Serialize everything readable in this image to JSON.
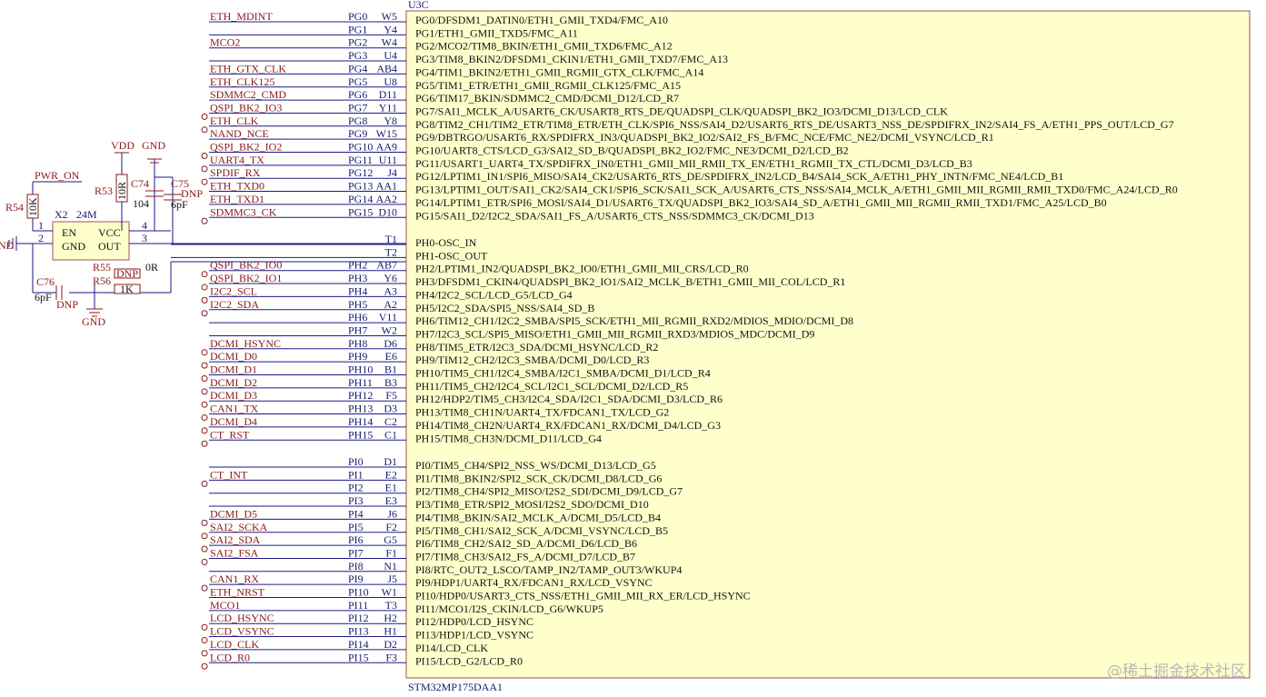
{
  "part": {
    "ref": "U3C",
    "name": "STM32MP175DAA1"
  },
  "pins_g": [
    {
      "net": "ETH_MDINT",
      "open": false,
      "pin": "PG0",
      "ball": "W5",
      "func": "PG0/DFSDM1_DATIN0/ETH1_GMII_TXD4/FMC_A10"
    },
    {
      "net": "",
      "open": false,
      "pin": "PG1",
      "ball": "Y4",
      "func": "PG1/ETH1_GMII_TXD5/FMC_A11"
    },
    {
      "net": "MCO2",
      "open": false,
      "pin": "PG2",
      "ball": "W4",
      "func": "PG2/MCO2/TIM8_BKIN/ETH1_GMII_TXD6/FMC_A12"
    },
    {
      "net": "",
      "open": false,
      "pin": "PG3",
      "ball": "U4",
      "func": "PG3/TIM8_BKIN2/DFSDM1_CKIN1/ETH1_GMII_TXD7/FMC_A13"
    },
    {
      "net": "ETH_GTX_CLK",
      "open": false,
      "pin": "PG4",
      "ball": "AB4",
      "func": "PG4/TIM1_BKIN2/ETH1_GMII_RGMII_GTX_CLK/FMC_A14"
    },
    {
      "net": "ETH_CLK125",
      "open": false,
      "pin": "PG5",
      "ball": "U8",
      "func": "PG5/TIM1_ETR/ETH1_GMII_RGMII_CLK125/FMC_A15"
    },
    {
      "net": "SDMMC2_CMD",
      "open": false,
      "pin": "PG6",
      "ball": "D11",
      "func": "PG6/TIM17_BKIN/SDMMC2_CMD/DCMI_D12/LCD_R7"
    },
    {
      "net": "QSPI_BK2_IO3",
      "open": true,
      "pin": "PG7",
      "ball": "Y11",
      "func": "PG7/SAI1_MCLK_A/USART6_CK/USART8_RTS_DE/QUADSPI_CLK/QUADSPI_BK2_IO3/DCMI_D13/LCD_CLK"
    },
    {
      "net": "ETH_CLK",
      "open": true,
      "pin": "PG8",
      "ball": "Y8",
      "func": "PG8/TIM2_CH1/TIM2_ETR/TIM8_ETR/ETH_CLK/SPI6_NSS/SAI4_D2/USART6_RTS_DE/USART3_NSS_DE/SPDIFRX_IN2/SAI4_FS_A/ETH1_PPS_OUT/LCD_G7"
    },
    {
      "net": "NAND_NCE",
      "open": false,
      "pin": "PG9",
      "ball": "W15",
      "func": "PG9/DBTRGO/USART6_RX/SPDIFRX_IN3/QUADSPI_BK2_IO2/SAI2_FS_B/FMC_NCE/FMC_NE2/DCMI_VSYNC/LCD_R1"
    },
    {
      "net": "QSPI_BK2_IO2",
      "open": true,
      "pin": "PG10",
      "ball": "AA9",
      "func": "PG10/UART8_CTS/LCD_G3/SAI2_SD_B/QUADSPI_BK2_IO2/FMC_NE3/DCMI_D2/LCD_B2"
    },
    {
      "net": "UART4_TX",
      "open": true,
      "pin": "PG11",
      "ball": "U11",
      "func": "PG11/USART1_UART4_TX/SPDIFRX_IN0/ETH1_GMII_MII_RMII_TX_EN/ETH1_RGMII_TX_CTL/DCMI_D3/LCD_B3"
    },
    {
      "net": "SPDIF_RX",
      "open": true,
      "pin": "PG12",
      "ball": "J4",
      "func": "PG12/LPTIM1_IN1/SPI6_MISO/SAI4_CK2/USART6_RTS_DE/SPDIFRX_IN2/LCD_B4/SAI4_SCK_A/ETH1_PHY_INTN/FMC_NE4/LCD_B1"
    },
    {
      "net": "ETH_TXD0",
      "open": false,
      "pin": "PG13",
      "ball": "AA1",
      "func": "PG13/LPTIM1_OUT/SAI1_CK2/SAI4_CK1/SPI6_SCK/SAI1_SCK_A/USART6_CTS_NSS/SAI4_MCLK_A/ETH1_GMII_MII_RGMII_RMII_TXD0/FMC_A24/LCD_R0"
    },
    {
      "net": "ETH_TXD1",
      "open": false,
      "pin": "PG14",
      "ball": "AA2",
      "func": "PG14/LPTIM1_ETR/SPI6_MOSI/SAI4_D1/USART6_TX/QUADSPI_BK2_IO3/SAI4_SD_A/ETH1_GMII_MII_RGMII_RMII_TXD1/FMC_A25/LCD_B0"
    },
    {
      "net": "SDMMC3_CK",
      "open": true,
      "pin": "PG15",
      "ball": "D10",
      "func": "PG15/SAI1_D2/I2C2_SDA/SAI1_FS_A/USART6_CTS_NSS/SDMMC3_CK/DCMI_D13"
    }
  ],
  "pins_h": [
    {
      "net": "",
      "open": false,
      "pin": "",
      "ball": "T1",
      "func": "PH0-OSC_IN"
    },
    {
      "net": "",
      "open": false,
      "pin": "",
      "ball": "T2",
      "func": "PH1-OSC_OUT"
    },
    {
      "net": "QSPI_BK2_IO0",
      "open": true,
      "pin": "PH2",
      "ball": "AB7",
      "func": "PH2/LPTIM1_IN2/QUADSPI_BK2_IO0/ETH1_GMII_MII_CRS/LCD_R0"
    },
    {
      "net": "QSPI_BK2_IO1",
      "open": true,
      "pin": "PH3",
      "ball": "Y6",
      "func": "PH3/DFSDM1_CKIN4/QUADSPI_BK2_IO1/SAI2_MCLK_B/ETH1_GMII_MII_COL/LCD_R1"
    },
    {
      "net": "I2C2_SCL",
      "open": true,
      "pin": "PH4",
      "ball": "A3",
      "func": "PH4/I2C2_SCL/LCD_G5/LCD_G4"
    },
    {
      "net": "I2C2_SDA",
      "open": true,
      "pin": "PH5",
      "ball": "A2",
      "func": "PH5/I2C2_SDA/SPI5_NSS/SAI4_SD_B"
    },
    {
      "net": "",
      "open": false,
      "pin": "PH6",
      "ball": "V11",
      "func": "PH6/TIM12_CH1/I2C2_SMBA/SPI5_SCK/ETH1_MII_RGMII_RXD2/MDIOS_MDIO/DCMI_D8"
    },
    {
      "net": "",
      "open": false,
      "pin": "PH7",
      "ball": "W2",
      "func": "PH7/I2C3_SCL/SPI5_MISO/ETH1_GMII_MII_RGMII_RXD3/MDIOS_MDC/DCMI_D9"
    },
    {
      "net": "DCMI_HSYNC",
      "open": true,
      "pin": "PH8",
      "ball": "D6",
      "func": "PH8/TIM5_ETR/I2C3_SDA/DCMI_HSYNC/LCD_R2"
    },
    {
      "net": "DCMI_D0",
      "open": true,
      "pin": "PH9",
      "ball": "E6",
      "func": "PH9/TIM12_CH2/I2C3_SMBA/DCMI_D0/LCD_R3"
    },
    {
      "net": "DCMI_D1",
      "open": true,
      "pin": "PH10",
      "ball": "B1",
      "func": "PH10/TIM5_CH1/I2C4_SMBA/I2C1_SMBA/DCMI_D1/LCD_R4"
    },
    {
      "net": "DCMI_D2",
      "open": true,
      "pin": "PH11",
      "ball": "B3",
      "func": "PH11/TIM5_CH2/I2C4_SCL/I2C1_SCL/DCMI_D2/LCD_R5"
    },
    {
      "net": "DCMI_D3",
      "open": true,
      "pin": "PH12",
      "ball": "F5",
      "func": "PH12/HDP2/TIM5_CH3/I2C4_SDA/I2C1_SDA/DCMI_D3/LCD_R6"
    },
    {
      "net": "CAN1_TX",
      "open": true,
      "pin": "PH13",
      "ball": "D3",
      "func": "PH13/TIM8_CH1N/UART4_TX/FDCAN1_TX/LCD_G2"
    },
    {
      "net": "DCMI_D4",
      "open": true,
      "pin": "PH14",
      "ball": "C2",
      "func": "PH14/TIM8_CH2N/UART4_RX/FDCAN1_RX/DCMI_D4/LCD_G3"
    },
    {
      "net": "CT_RST",
      "open": true,
      "pin": "PH15",
      "ball": "C1",
      "func": "PH15/TIM8_CH3N/DCMI_D11/LCD_G4"
    }
  ],
  "pins_i": [
    {
      "net": "",
      "open": false,
      "pin": "PI0",
      "ball": "D1",
      "func": "PI0/TIM5_CH4/SPI2_NSS_WS/DCMI_D13/LCD_G5"
    },
    {
      "net": "CT_INT",
      "open": true,
      "pin": "PI1",
      "ball": "E2",
      "func": "PI1/TIM8_BKIN2/SPI2_SCK_CK/DCMI_D8/LCD_G6"
    },
    {
      "net": "",
      "open": false,
      "pin": "PI2",
      "ball": "E1",
      "func": "PI2/TIM8_CH4/SPI2_MISO/I2S2_SDI/DCMI_D9/LCD_G7"
    },
    {
      "net": "",
      "open": false,
      "pin": "PI3",
      "ball": "E3",
      "func": "PI3/TIM8_ETR/SPI2_MOSI/I2S2_SDO/DCMI_D10"
    },
    {
      "net": "DCMI_D5",
      "open": true,
      "pin": "PI4",
      "ball": "J6",
      "func": "PI4/TIM8_BKIN/SAI2_MCLK_A/DCMI_D5/LCD_B4"
    },
    {
      "net": "SAI2_SCKA",
      "open": true,
      "pin": "PI5",
      "ball": "F2",
      "func": "PI5/TIM8_CH1/SAI2_SCK_A/DCMI_VSYNC/LCD_B5"
    },
    {
      "net": "SAI2_SDA",
      "open": true,
      "pin": "PI6",
      "ball": "G5",
      "func": "PI6/TIM8_CH2/SAI2_SD_A/DCMI_D6/LCD_B6"
    },
    {
      "net": "SAI2_FSA",
      "open": true,
      "pin": "PI7",
      "ball": "F1",
      "func": "PI7/TIM8_CH3/SAI2_FS_A/DCMI_D7/LCD_B7"
    },
    {
      "net": "",
      "open": false,
      "pin": "PI8",
      "ball": "N1",
      "func": "PI8/RTC_OUT2_LSCO/TAMP_IN2/TAMP_OUT3/WKUP4"
    },
    {
      "net": "CAN1_RX",
      "open": true,
      "pin": "PI9",
      "ball": "J5",
      "func": "PI9/HDP1/UART4_RX/FDCAN1_RX/LCD_VSYNC"
    },
    {
      "net": "ETH_NRST",
      "open": false,
      "pin": "PI10",
      "ball": "W1",
      "func": "PI10/HDP0/USART3_CTS_NSS/ETH1_GMII_MII_RX_ER/LCD_HSYNC"
    },
    {
      "net": "MCO1",
      "open": false,
      "pin": "PI11",
      "ball": "T3",
      "func": "PI11/MCO1/I2S_CKIN/LCD_G6/WKUP5"
    },
    {
      "net": "LCD_HSYNC",
      "open": true,
      "pin": "PI12",
      "ball": "H2",
      "func": "PI12/HDP0/LCD_HSYNC"
    },
    {
      "net": "LCD_VSYNC",
      "open": true,
      "pin": "PI13",
      "ball": "H1",
      "func": "PI13/HDP1/LCD_VSYNC"
    },
    {
      "net": "LCD_CLK",
      "open": true,
      "pin": "PI14",
      "ball": "D2",
      "func": "PI14/LCD_CLK"
    },
    {
      "net": "LCD_R0",
      "open": true,
      "pin": "PI15",
      "ball": "F3",
      "func": "PI15/LCD_G2/LCD_R0"
    }
  ],
  "osc": {
    "ref": "X2",
    "value": "24M",
    "pin_en": "EN",
    "pin_vcc": "VCC",
    "pin_gnd": "GND",
    "pin_out": "OUT",
    "n1": "1",
    "n2": "2",
    "n3": "3",
    "n4": "4",
    "net_pwr": "PWR_ON",
    "vdd": "VDD",
    "gnd": "GND",
    "gnd_left": "ND",
    "r54": "R54",
    "r54_val": "10K",
    "r53": "R53",
    "r53_val": "10R",
    "c74": "C74",
    "c74_val": "104",
    "c75": "C75",
    "c75_val": "6pF",
    "c75_dnp": "DNP",
    "c76": "C76",
    "c76_val": "6pF",
    "c76_dnp": "DNP",
    "r55": "R55",
    "r55_box": "DNP",
    "r55_val": "0R",
    "r56": "R56",
    "r56_box": "1K"
  },
  "watermark": "@稀土掘金技术社区",
  "colors": {
    "wire": "#1a1a8a",
    "net": "#8b1a1a",
    "pin": "#1a1a6e",
    "body_fill": "#ffffcc",
    "body_stroke": "#a0505a",
    "comp": "#8b1a1a"
  }
}
